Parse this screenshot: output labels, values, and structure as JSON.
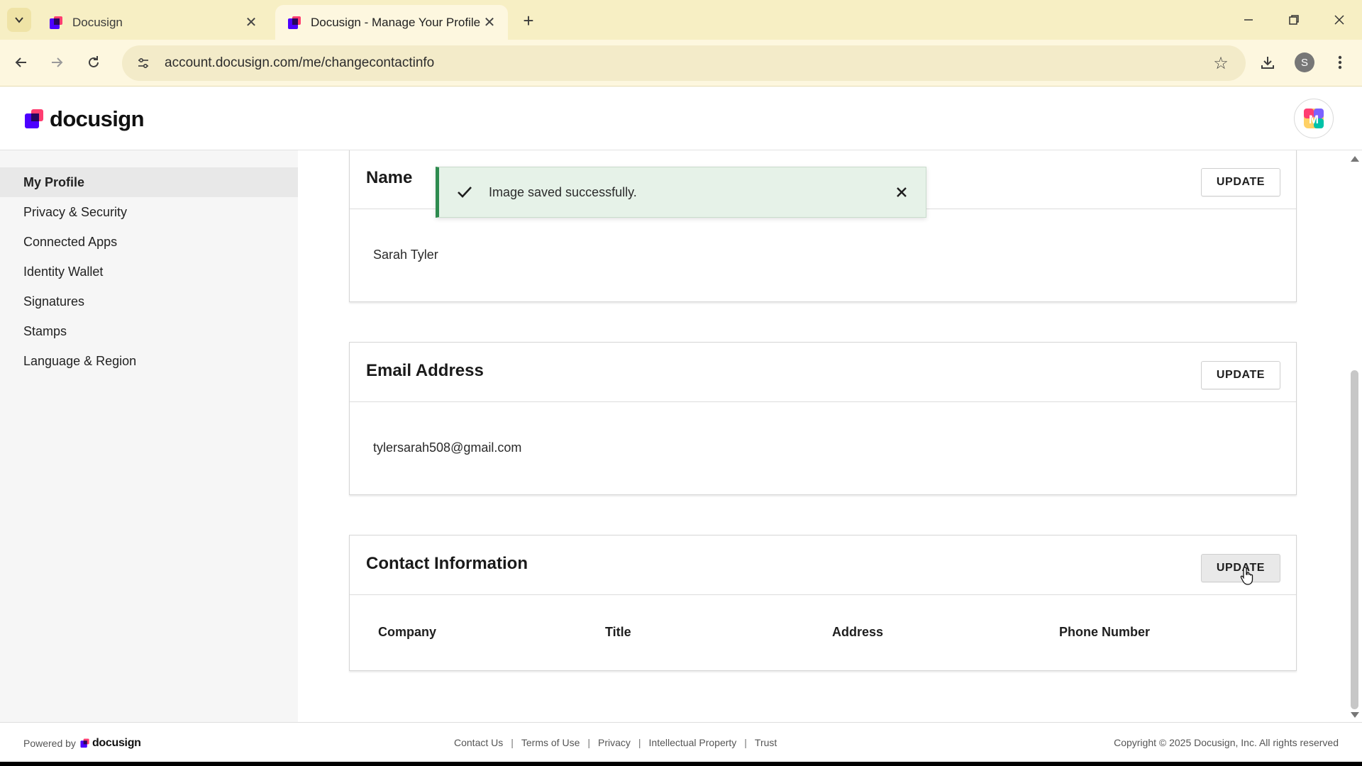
{
  "browser": {
    "tabs": [
      {
        "title": "Docusign",
        "active": false
      },
      {
        "title": "Docusign - Manage Your Profile",
        "active": true
      }
    ],
    "url": "account.docusign.com/me/changecontactinfo",
    "profile_initial": "S"
  },
  "header": {
    "logo_text": "docusign",
    "avatar_initial": "M"
  },
  "sidebar": {
    "items": [
      {
        "label": "My Profile",
        "active": true
      },
      {
        "label": "Privacy & Security",
        "active": false
      },
      {
        "label": "Connected Apps",
        "active": false
      },
      {
        "label": "Identity Wallet",
        "active": false
      },
      {
        "label": "Signatures",
        "active": false
      },
      {
        "label": "Stamps",
        "active": false
      },
      {
        "label": "Language & Region",
        "active": false
      }
    ]
  },
  "toast": {
    "message": "Image saved successfully.",
    "status": "success"
  },
  "sections": {
    "name": {
      "title": "Name",
      "value": "Sarah Tyler",
      "button": "UPDATE"
    },
    "email": {
      "title": "Email Address",
      "value": "tylersarah508@gmail.com",
      "button": "UPDATE"
    },
    "contact": {
      "title": "Contact Information",
      "button": "UPDATE",
      "columns": [
        "Company",
        "Title",
        "Address",
        "Phone Number"
      ]
    }
  },
  "footer": {
    "powered_by": "Powered by",
    "powered_logo": "docusign",
    "links": [
      "Contact Us",
      "Terms of Use",
      "Privacy",
      "Intellectual Property",
      "Trust"
    ],
    "copyright": "Copyright © 2025 Docusign, Inc. All rights reserved"
  },
  "colors": {
    "brand_purple": "#4c00ff",
    "brand_red": "#ff3d71",
    "success_green": "#2e8b4f",
    "tabbar_bg": "#f7efc4"
  }
}
